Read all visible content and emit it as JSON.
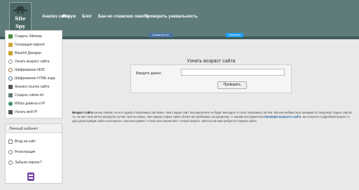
{
  "header": {
    "logo_line1": "Site",
    "logo_line2": "Spy",
    "nav": [
      {
        "label": "Анализ сайта"
      },
      {
        "label": "Форум"
      },
      {
        "label": "Блог"
      },
      {
        "label": "Бан-во спамских пакета"
      },
      {
        "label": "Проверить уникальность"
      }
    ]
  },
  "sidebar": {
    "items": [
      {
        "label": "Создать Sitemap",
        "icon": "sitemap-icon",
        "color": "#4a8f3c"
      },
      {
        "label": "Генерация пароля",
        "icon": "key-icon",
        "color": "#d1a23a"
      },
      {
        "label": "Base64 Декодер",
        "icon": "base64-icon",
        "color": "#c9a12c"
      },
      {
        "label": "Узнать возраст сайта",
        "icon": "clock-icon",
        "color": "#888888"
      },
      {
        "label": "Шифрование MD5",
        "icon": "lock-icon",
        "color": "#8f6a3c"
      },
      {
        "label": "Шифрование HTML кода",
        "icon": "code-icon",
        "color": "#3c6a8f"
      },
      {
        "label": "Анализ ссылок сайта",
        "icon": "link-icon",
        "color": "#555555"
      },
      {
        "label": "Создать robots.txt",
        "icon": "robot-icon",
        "color": "#5f7c7b"
      },
      {
        "label": "Whois домена и IP",
        "icon": "whois-icon",
        "color": "#3c8f6a"
      },
      {
        "label": "Узнать мой IP",
        "icon": "ip-icon",
        "color": "#555555"
      }
    ]
  },
  "cabinet": {
    "title": "Личный кабинет",
    "items": [
      {
        "label": "Вход на сайт",
        "icon": "login-icon"
      },
      {
        "label": "Регистрация",
        "icon": "register-icon"
      },
      {
        "label": "Забыли пароль?",
        "icon": "question-icon"
      }
    ]
  },
  "share": {
    "vk": "Нравится 15",
    "twitter": "Твитнуть"
  },
  "main": {
    "heading": "Узнать возраст сайта",
    "domain_label": "Введите домен:",
    "domain_value": "",
    "check_button": "Проверить"
  },
  "description": {
    "lead": "Возраст сайта",
    "text1": " сильно влияет на его судьбу в поисковых системах. Чем старше сайт тем вероятнее он будет выходить в топах поисковых систем. Многие вебмастера занимаются покупкой старых сайтов, т.к. на них получается раскрутка лучше чем на новых, тем самым старые сайты более востребованы на аукционах. С нашим инструментом",
    "link": "проверки возраста сайта",
    "text2": ", вы получите подробный возраст и дату регистрации сайта в интернете. Наш инструмент точнее всех вычисляет точный возраст сайта если вам требуется покупка сайта."
  },
  "colors": {
    "header_bg": "#5f7c7b",
    "page_bg": "#e9e9e9",
    "link": "#1f5e9c"
  }
}
